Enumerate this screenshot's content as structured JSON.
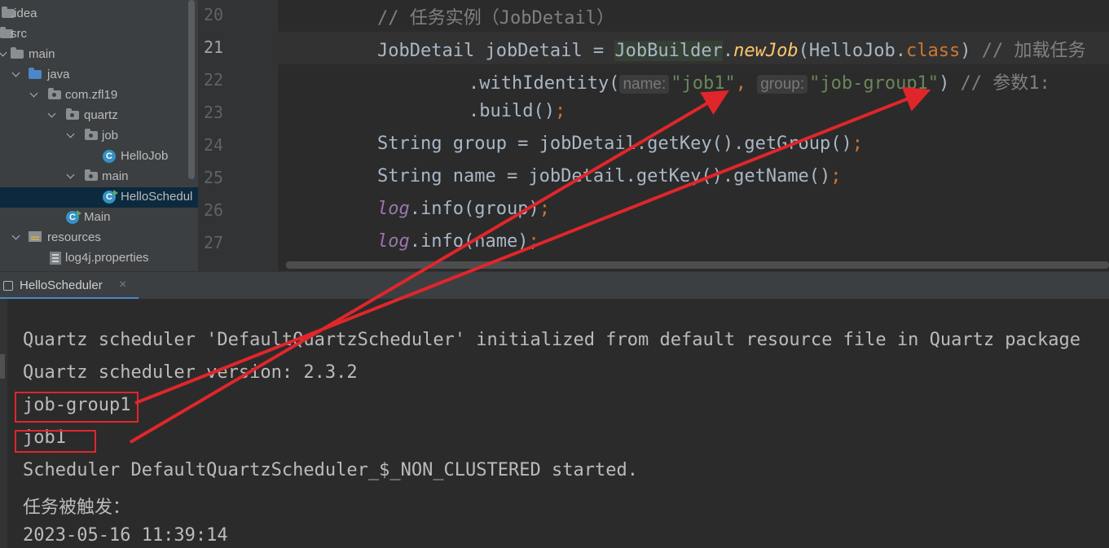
{
  "project_tree": {
    "items": [
      {
        "label": ".idea",
        "type": "folder",
        "level": 0,
        "expanded": false
      },
      {
        "label": "src",
        "type": "folder",
        "level": 0,
        "expanded": false
      },
      {
        "label": "main",
        "type": "folder",
        "level": 1,
        "expanded": true
      },
      {
        "label": "java",
        "type": "source-folder",
        "level": 2,
        "expanded": true
      },
      {
        "label": "com.zfl19",
        "type": "package",
        "level": 3,
        "expanded": true
      },
      {
        "label": "quartz",
        "type": "package",
        "level": 4,
        "expanded": true
      },
      {
        "label": "job",
        "type": "package",
        "level": 5,
        "expanded": true
      },
      {
        "label": "HelloJob",
        "type": "class",
        "level": 6
      },
      {
        "label": "main",
        "type": "package",
        "level": 5,
        "expanded": true
      },
      {
        "label": "HelloSchedul",
        "type": "runnable-class",
        "level": 6,
        "selected": true
      },
      {
        "label": "Main",
        "type": "runnable-class",
        "level": 4
      },
      {
        "label": "resources",
        "type": "resources-folder",
        "level": 2,
        "expanded": true
      },
      {
        "label": "log4j.properties",
        "type": "properties-file",
        "level": 3
      }
    ]
  },
  "editor": {
    "current_line": "21",
    "lines": [
      {
        "num": "20"
      },
      {
        "num": "21"
      },
      {
        "num": "22"
      },
      {
        "num": "23"
      },
      {
        "num": "24"
      },
      {
        "num": "25"
      },
      {
        "num": "26"
      },
      {
        "num": "27"
      }
    ],
    "code": {
      "l20_comment": "// 任务实例（JobDetail）",
      "l21_type": "JobDetail jobDetail = ",
      "l21_builder": "JobBuilder",
      "l21_dot": ".",
      "l21_method": "newJob",
      "l21_open": "(HelloJob.",
      "l21_class_kw": "class",
      "l21_close": ") ",
      "l21_comment": "// 加载任务",
      "l22_method": ".withIdentity(",
      "l22_hint_name": "name:",
      "l22_arg1": "\"job1\"",
      "l22_sep": ", ",
      "l22_hint_group": "group:",
      "l22_arg2": "\"job-group1\"",
      "l22_close": ") ",
      "l22_comment": "// 参数1:",
      "l23_build": ".build()",
      "l24_code": "String group = jobDetail.getKey().getGroup()",
      "l25_code": "String name = jobDetail.getKey().getName()",
      "l26_log": "log",
      "l26_rest": ".info(group)",
      "l27_log": "log",
      "l27_rest": ".info(name)",
      "semicolon": ";"
    }
  },
  "run_panel": {
    "tab_label": "HelloScheduler",
    "close_glyph": "×",
    "output": [
      "Quartz scheduler 'DefaultQuartzScheduler' initialized from default resource file in Quartz package",
      "Quartz scheduler version: 2.3.2",
      "job-group1",
      "job1",
      "Scheduler DefaultQuartzScheduler_$_NON_CLUSTERED started.",
      "任务被触发：",
      "2023-05-16 11:39:14"
    ]
  },
  "annotation": {
    "color": "#e0262b"
  },
  "theme": {
    "editor_bg": "#2b2b2b",
    "panel_bg": "#3c3f41",
    "keyword": "#cc7832",
    "string": "#6a8759",
    "comment": "#808080",
    "method": "#ffc66d",
    "field": "#9876aa",
    "selection": "#0d293e"
  }
}
